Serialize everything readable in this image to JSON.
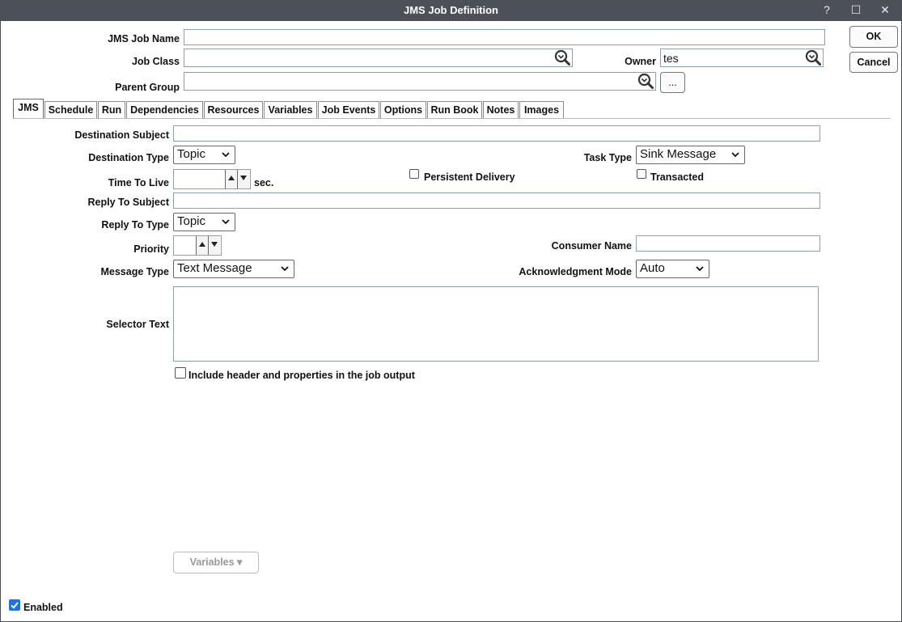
{
  "window": {
    "title": "JMS Job Definition",
    "help_glyph": "?",
    "maximize_glyph": "☐",
    "close_glyph": "✕"
  },
  "header": {
    "job_name_label": "JMS Job Name",
    "job_name_value": "",
    "job_class_label": "Job Class",
    "job_class_value": "",
    "owner_label": "Owner",
    "owner_value": "tes",
    "parent_group_label": "Parent Group",
    "parent_group_value": "",
    "browse_label": "...",
    "ok_label": "OK",
    "cancel_label": "Cancel"
  },
  "tabs": [
    {
      "label": "JMS",
      "active": true
    },
    {
      "label": "Schedule"
    },
    {
      "label": "Run"
    },
    {
      "label": "Dependencies"
    },
    {
      "label": "Resources"
    },
    {
      "label": "Variables"
    },
    {
      "label": "Job Events"
    },
    {
      "label": "Options"
    },
    {
      "label": "Run Book"
    },
    {
      "label": "Notes"
    },
    {
      "label": "Images"
    }
  ],
  "jms": {
    "destination_subject_label": "Destination Subject",
    "destination_subject_value": "",
    "destination_type_label": "Destination Type",
    "destination_type_value": "Topic",
    "task_type_label": "Task Type",
    "task_type_value": "Sink Message",
    "time_to_live_label": "Time To Live",
    "time_to_live_value": "",
    "time_to_live_unit": "sec.",
    "persistent_delivery_label": "Persistent Delivery",
    "transacted_label": "Transacted",
    "reply_to_subject_label": "Reply To Subject",
    "reply_to_subject_value": "",
    "reply_to_type_label": "Reply To Type",
    "reply_to_type_value": "Topic",
    "priority_label": "Priority",
    "priority_value": "",
    "consumer_name_label": "Consumer Name",
    "consumer_name_value": "",
    "message_type_label": "Message Type",
    "message_type_value": "Text Message",
    "ack_mode_label": "Acknowledgment Mode",
    "ack_mode_value": "Auto",
    "selector_text_label": "Selector Text",
    "selector_text_value": "",
    "include_header_label": "Include header and properties in the job output",
    "variables_button_label": "Variables ▾"
  },
  "footer": {
    "enabled_label": "Enabled"
  },
  "colors": {
    "titlebar": "#4c5159",
    "checkbox_checked": "#1a73e8"
  }
}
